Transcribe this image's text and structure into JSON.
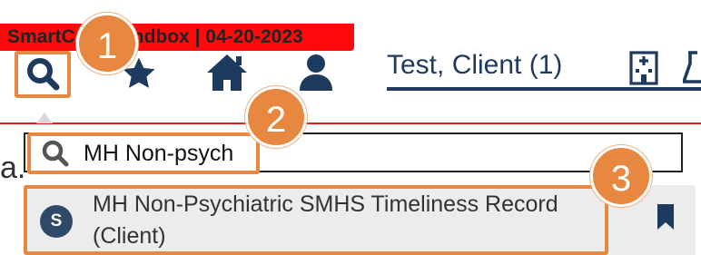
{
  "banner": {
    "text": "SmartCare Sandbox | 04-20-2023"
  },
  "client": {
    "name": "Test, Client (1)"
  },
  "search": {
    "value": "MH Non-psych",
    "partial_left_text": "a."
  },
  "result": {
    "avatar_letter": "S",
    "title_line1": "MH Non-Psychiatric SMHS Timeliness Record",
    "title_line2": "(Client)"
  },
  "steps": [
    "1",
    "2",
    "3"
  ],
  "icons": [
    "search-icon",
    "star-icon",
    "home-icon",
    "user-icon",
    "hospital-icon",
    "flask-icon",
    "bookmark-icon"
  ],
  "colors": {
    "accent": "#e8873f",
    "banner": "#ff0a0a",
    "navy": "#1e3a5f",
    "avatar": "#2f4a66"
  }
}
